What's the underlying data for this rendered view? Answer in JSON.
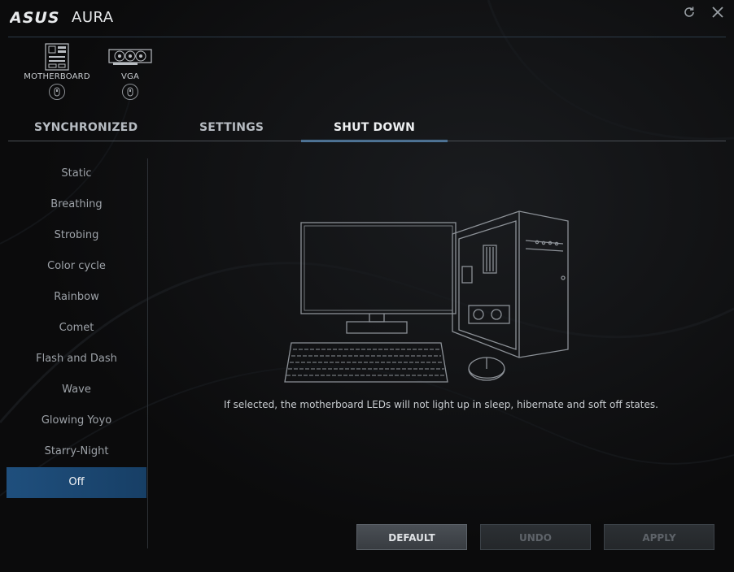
{
  "window": {
    "brand": "ASUS",
    "title": "AURA",
    "refresh_icon": "refresh-icon",
    "close_icon": "close-icon"
  },
  "devices": [
    {
      "label": "MOTHERBOARD",
      "icon": "motherboard-icon"
    },
    {
      "label": "VGA",
      "icon": "graphics-card-icon"
    }
  ],
  "tabs": [
    {
      "label": "SYNCHRONIZED",
      "active": false
    },
    {
      "label": "SETTINGS",
      "active": false
    },
    {
      "label": "SHUT DOWN",
      "active": true
    }
  ],
  "effects": [
    {
      "label": "Static"
    },
    {
      "label": "Breathing"
    },
    {
      "label": "Strobing"
    },
    {
      "label": "Color cycle"
    },
    {
      "label": "Rainbow"
    },
    {
      "label": "Comet"
    },
    {
      "label": "Flash and Dash"
    },
    {
      "label": "Wave"
    },
    {
      "label": "Glowing Yoyo"
    },
    {
      "label": "Starry-Night"
    },
    {
      "label": "Off",
      "selected": true
    }
  ],
  "main": {
    "illustration": "pc-setup-illustration",
    "description": "If selected, the motherboard LEDs will not light up in sleep, hibernate and soft off states."
  },
  "actions": {
    "default_label": "DEFAULT",
    "undo_label": "UNDO",
    "apply_label": "APPLY"
  },
  "colors": {
    "accent": "#4f86b8",
    "selected_bg": "#1f4f7d",
    "background": "#0b0b0c"
  }
}
